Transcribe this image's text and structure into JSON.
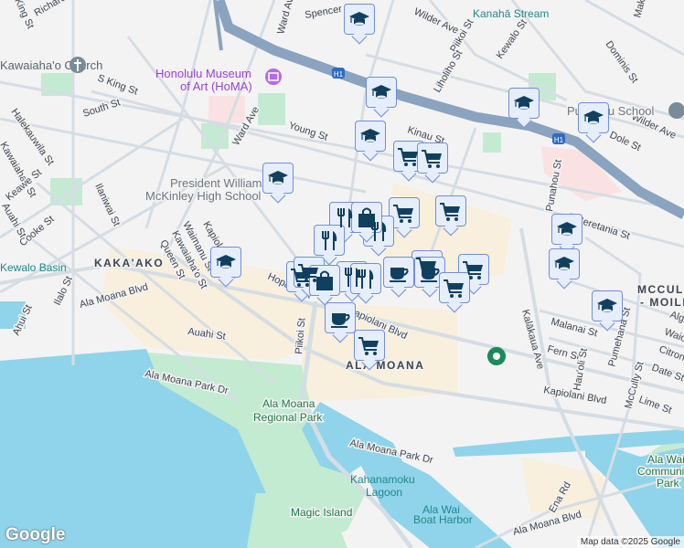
{
  "map": {
    "neighborhoods": [
      "KAKA'AKO",
      "ALA MOANA",
      "MCCULLY",
      "- MOILIILI"
    ],
    "streets": [
      "S King St",
      "South St",
      "Halekauwila St",
      "Kawaiahao St",
      "Keawe St",
      "Auahi St",
      "Cooke St",
      "Ilaniwai St",
      "Ward Ave",
      "Young St",
      "Kinau St",
      "Kapiolani Blvd",
      "Waimanu St",
      "Kawaiaha'o St",
      "Queen St",
      "Ala Moana Blvd",
      "Auahi St",
      "Ilalo St",
      "Ahui St",
      "Hopaka St",
      "Piikoi St",
      "Kapiolani Blvd",
      "Ala Moana Park Dr",
      "Ala Moana Park Dr",
      "Kalākaua Ave",
      "Malanai St",
      "Fern St",
      "Hau'oli St",
      "Pumehana St",
      "McCully St",
      "Lime St",
      "Date St",
      "Citron St",
      "Waiola St",
      "Algaroba St",
      "Kapiolani Blvd",
      "Ena Rd",
      "Ala Moana Blvd",
      "S Beretania St",
      "Punahou St",
      "Dole St",
      "Wilder Ave",
      "Wilder Ave",
      "Dominis St",
      "Kewalo St",
      "Piikoi St",
      "Liholiho St",
      "Spencer St",
      "Ward Ave",
      "Makiki St",
      "Richards St",
      "King St"
    ],
    "pois": {
      "church": "Kawaiaha'o Church",
      "museum_line1": "Honolulu Museum",
      "museum_line2": "of Art (HoMA)",
      "school1_line1": "President William",
      "school1_line2": "McKinley High School",
      "school2": "Punahou School",
      "stream": "Kanahā Stream",
      "basin": "Kewalo Basin",
      "park_line1": "Ala Moana",
      "park_line2": "Regional Park",
      "lagoon_line1": "Kahanamoku",
      "lagoon_line2": "Lagoon",
      "harbor_line1": "Ala Wai",
      "harbor_line2": "Boat Harbor",
      "island": "Magic Island",
      "comm_line1": "Ala Wai",
      "comm_line2": "Community",
      "comm_line3": "Park",
      "highway": "H1"
    },
    "markers": [
      {
        "icon": "school-icon"
      },
      {
        "icon": "school-icon"
      },
      {
        "icon": "school-icon"
      },
      {
        "icon": "school-icon"
      },
      {
        "icon": "school-icon"
      },
      {
        "icon": "school-icon"
      },
      {
        "icon": "school-icon"
      },
      {
        "icon": "school-icon"
      },
      {
        "icon": "school-icon"
      },
      {
        "icon": "school-icon"
      },
      {
        "icon": "shopping-cart-icon"
      },
      {
        "icon": "shopping-cart-icon"
      },
      {
        "icon": "shopping-cart-icon"
      },
      {
        "icon": "shopping-cart-icon"
      },
      {
        "icon": "restaurant-icon"
      },
      {
        "icon": "restaurant-icon"
      },
      {
        "icon": "shopping-bag-icon"
      },
      {
        "icon": "restaurant-icon"
      },
      {
        "icon": "shopping-cart-icon"
      },
      {
        "icon": "shopping-cart-icon"
      },
      {
        "icon": "shopping-cart-icon"
      },
      {
        "icon": "shopping-cart-icon"
      },
      {
        "icon": "restaurant-icon"
      },
      {
        "icon": "restaurant-icon"
      },
      {
        "icon": "shopping-bag-icon"
      },
      {
        "icon": "cafe-icon"
      },
      {
        "icon": "cafe-icon"
      },
      {
        "icon": "cafe-icon"
      },
      {
        "icon": "shopping-cart-icon"
      },
      {
        "icon": "shopping-cart-icon"
      }
    ],
    "colors": {
      "water": "#8fd4ea",
      "park": "#c3ebd2",
      "commercial": "#f8efdc",
      "highway": "#8aa3bf",
      "road": "#d5dde4",
      "marker_bg": "#e6eefc",
      "marker_border": "#6f8fd8",
      "marker_icon": "#10405f"
    }
  },
  "footer": {
    "logo": "Google",
    "attribution": "Map data ©2025 Google"
  }
}
